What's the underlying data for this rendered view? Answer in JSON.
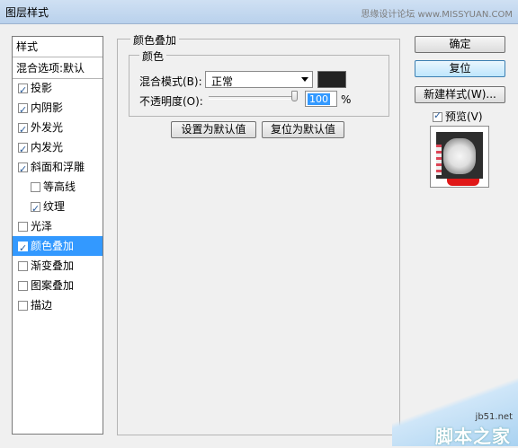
{
  "window": {
    "title": "图层样式",
    "watermark_top": "思缘设计论坛 www.MISSYUAN.COM"
  },
  "left_panel": {
    "header": "样式",
    "blend_options": "混合选项:默认",
    "items": [
      {
        "label": "投影",
        "checked": true,
        "indent": false,
        "selected": false
      },
      {
        "label": "内阴影",
        "checked": true,
        "indent": false,
        "selected": false
      },
      {
        "label": "外发光",
        "checked": true,
        "indent": false,
        "selected": false
      },
      {
        "label": "内发光",
        "checked": true,
        "indent": false,
        "selected": false
      },
      {
        "label": "斜面和浮雕",
        "checked": true,
        "indent": false,
        "selected": false
      },
      {
        "label": "等高线",
        "checked": false,
        "indent": true,
        "selected": false
      },
      {
        "label": "纹理",
        "checked": true,
        "indent": true,
        "selected": false
      },
      {
        "label": "光泽",
        "checked": false,
        "indent": false,
        "selected": false
      },
      {
        "label": "颜色叠加",
        "checked": true,
        "indent": false,
        "selected": true
      },
      {
        "label": "渐变叠加",
        "checked": false,
        "indent": false,
        "selected": false
      },
      {
        "label": "图案叠加",
        "checked": false,
        "indent": false,
        "selected": false
      },
      {
        "label": "描边",
        "checked": false,
        "indent": false,
        "selected": false
      }
    ]
  },
  "overlay": {
    "group_title": "颜色叠加",
    "sub_title": "颜色",
    "blend_mode_label": "混合模式(B):",
    "blend_mode_value": "正常",
    "color_value": "#222222",
    "opacity_label": "不透明度(O):",
    "opacity_value": "100",
    "opacity_unit": "%",
    "set_default": "设置为默认值",
    "reset_default": "复位为默认值"
  },
  "buttons": {
    "ok": "确定",
    "reset": "复位",
    "new_style": "新建样式(W)...",
    "preview_label": "预览(V)",
    "preview_checked": true
  },
  "watermark": {
    "url": "jb51.net",
    "site": "脚本之家"
  }
}
